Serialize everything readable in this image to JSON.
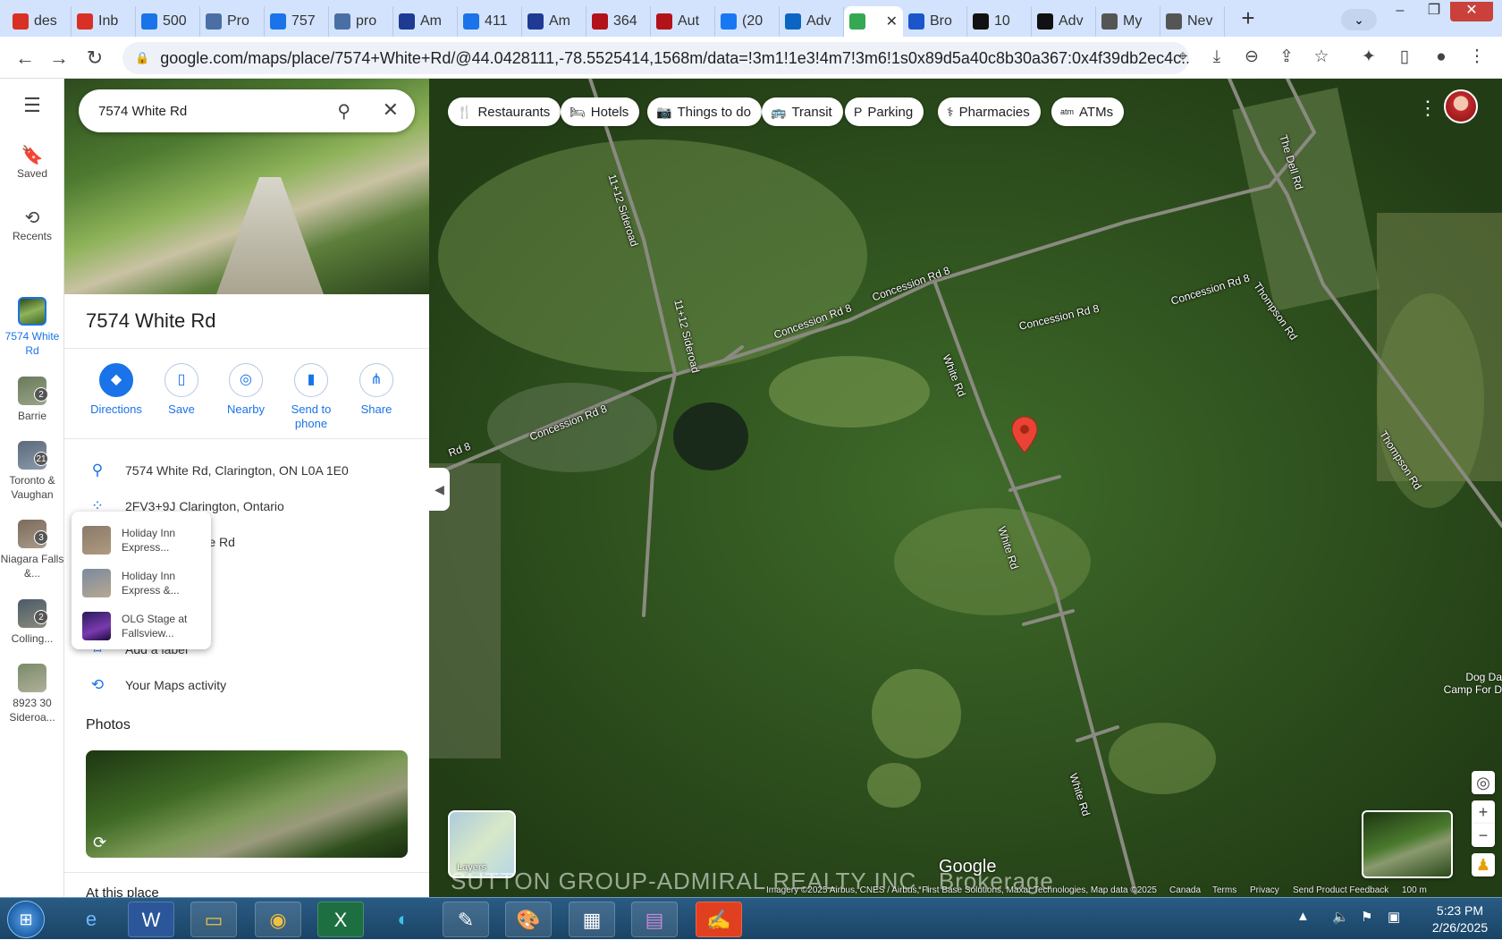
{
  "browser": {
    "tabs": [
      {
        "label": "des",
        "icon": "gmail-icon",
        "color": "#d93025"
      },
      {
        "label": "Inb",
        "icon": "gmail-icon",
        "color": "#d93025"
      },
      {
        "label": "500",
        "icon": "signature-icon",
        "color": "#1a73e8"
      },
      {
        "label": "Pro",
        "icon": "grid-icon",
        "color": "#4a6fa5"
      },
      {
        "label": "757",
        "icon": "signature-icon",
        "color": "#1a73e8"
      },
      {
        "label": "pro",
        "icon": "link-icon",
        "color": "#4a6fa5"
      },
      {
        "label": "Am",
        "icon": "bars-icon",
        "color": "#1f3a93"
      },
      {
        "label": "411",
        "icon": "signature-icon",
        "color": "#1a73e8"
      },
      {
        "label": "Am",
        "icon": "bars-icon",
        "color": "#1f3a93"
      },
      {
        "label": "364",
        "icon": "arrow-icon",
        "color": "#b3121a"
      },
      {
        "label": "Aut",
        "icon": "arrow-icon",
        "color": "#b3121a"
      },
      {
        "label": "(20",
        "icon": "facebook-icon",
        "color": "#1877f2"
      },
      {
        "label": "Adv",
        "icon": "linkedin-icon",
        "color": "#0a66c2"
      },
      {
        "label": "",
        "icon": "maps-pin-icon",
        "color": "#34a853",
        "active": true
      },
      {
        "label": "Bro",
        "icon": "house-icon",
        "color": "#1a56c9"
      },
      {
        "label": "10",
        "icon": "circle-icon",
        "color": "#111111"
      },
      {
        "label": "Adv",
        "icon": "wave-icon",
        "color": "#111111"
      },
      {
        "label": "My",
        "icon": "globe-icon",
        "color": "#555555"
      },
      {
        "label": "Nev",
        "icon": "chrome-icon",
        "color": "#555555"
      }
    ],
    "url": "google.com/maps/place/7574+White+Rd/@44.0428111,-78.5525414,1568m/data=!3m1!1e3!4m7!3m6!1s0x89d5a40c8b30a367:0x4f39db2ec4c..."
  },
  "rail": {
    "menu": "☰",
    "items": [
      {
        "label": "Saved",
        "icon": "bookmark-icon"
      },
      {
        "label": "Recents",
        "icon": "history-icon"
      },
      {
        "label": "7574 White Rd",
        "icon": "place-thumb",
        "badge": ""
      },
      {
        "label": "Barrie",
        "icon": "place-thumb",
        "badge": "2"
      },
      {
        "label": "Toronto & Vaughan",
        "icon": "place-thumb",
        "badge": "21"
      },
      {
        "label": "Niagara Falls &...",
        "icon": "place-thumb",
        "badge": "3"
      },
      {
        "label": "Colling...",
        "icon": "place-thumb",
        "badge": "2"
      },
      {
        "label": "8923 30 Sideroa...",
        "icon": "place-thumb",
        "badge": ""
      }
    ]
  },
  "panel": {
    "search_value": "7574 White Rd",
    "title": "7574 White Rd",
    "actions": [
      {
        "label": "Directions"
      },
      {
        "label": "Save"
      },
      {
        "label": "Nearby"
      },
      {
        "label": "Send to phone"
      },
      {
        "label": "Share"
      }
    ],
    "info": [
      {
        "text": "7574 White Rd, Clarington, ON L0A 1E0",
        "icon": "location-pin-icon"
      },
      {
        "text": "2FV3+9J Clarington, Ontario",
        "icon": "plus-code-icon"
      },
      {
        "text": "it on 7574 White Rd",
        "icon": "visit-icon"
      },
      {
        "text": "place",
        "icon": "add-place-icon"
      },
      {
        "text": "ness",
        "icon": "business-icon"
      },
      {
        "text": "Add a label",
        "icon": "label-icon"
      },
      {
        "text": "Your Maps activity",
        "icon": "history-icon"
      }
    ],
    "photos_heading": "Photos",
    "at_place": "At this place"
  },
  "hover_card": {
    "items": [
      {
        "line1": "Holiday Inn",
        "line2": "Express..."
      },
      {
        "line1": "Holiday Inn",
        "line2": "Express &..."
      },
      {
        "line1": "OLG Stage at",
        "line2": "Fallsview..."
      }
    ]
  },
  "map": {
    "chips": [
      {
        "label": "Restaurants",
        "icon": "fork-knife-icon"
      },
      {
        "label": "Hotels",
        "icon": "bed-icon"
      },
      {
        "label": "Things to do",
        "icon": "camera-icon"
      },
      {
        "label": "Transit",
        "icon": "bus-icon"
      },
      {
        "label": "Parking",
        "icon": "parking-icon"
      },
      {
        "label": "Pharmacies",
        "icon": "pharmacy-icon"
      },
      {
        "label": "ATMs",
        "icon": "atm-icon"
      }
    ],
    "road_labels": [
      "11+12 Sideroad",
      "11+12 Sideroad",
      "Concession Rd 8",
      "Concession Rd 8",
      "Concession Rd 8",
      "Concession Rd 8",
      "Concession Rd 8",
      "Rd 8",
      "White Rd",
      "White Rd",
      "White Rd",
      "Thompson Rd",
      "Thompson Rd",
      "The Dell Rd"
    ],
    "poi": "Dog Da Camp For D",
    "layers_label": "Layers",
    "watermark": "SUTTON GROUP-ADMIRAL REALTY INC., Brokerage",
    "google_logo": "Google",
    "attribution": "Imagery ©2025 Airbus, CNES / Airbus, First Base Solutions, Maxar Technologies, Map data ©2025",
    "footer_links": [
      "Canada",
      "Terms",
      "Privacy",
      "Send Product Feedback",
      "100 m"
    ]
  },
  "taskbar": {
    "time": "5:23 PM",
    "date": "2/26/2025"
  },
  "colors": {
    "accent": "#1a73e8",
    "marker": "#ea4335",
    "tab_strip": "#d3e3fd"
  }
}
